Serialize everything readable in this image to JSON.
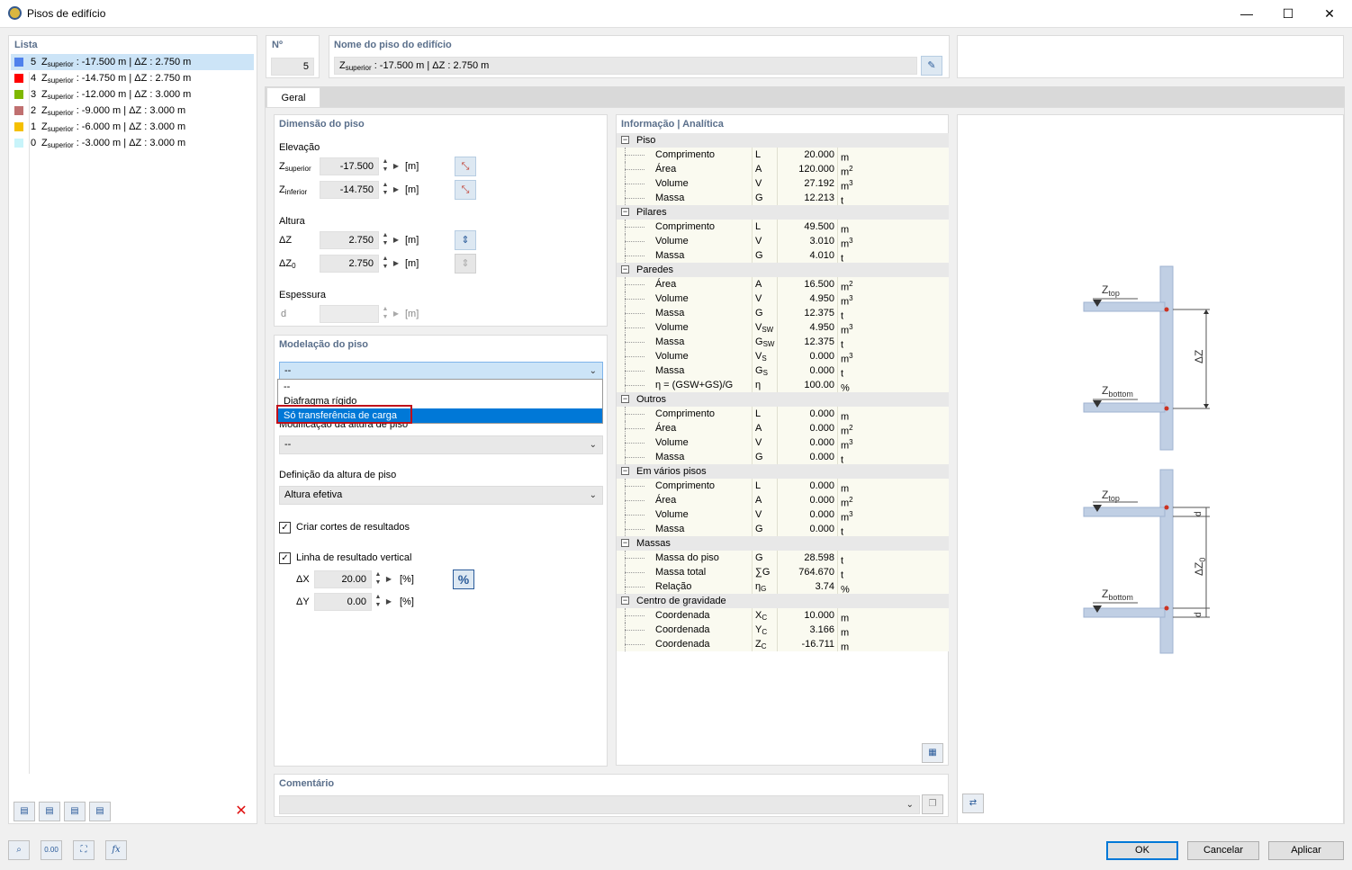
{
  "window": {
    "title": "Pisos de edifício",
    "controls": {
      "minimize": "—",
      "maximize": "☐",
      "close": "✕"
    }
  },
  "list": {
    "header": "Lista",
    "items": [
      {
        "n": "5",
        "color": "#4f81ec",
        "label_pre": "Z",
        "label_sub": "superior",
        "label_post": " : -17.500 m | ΔZ : 2.750 m",
        "selected": true
      },
      {
        "n": "4",
        "color": "#ff0000",
        "label_pre": "Z",
        "label_sub": "superior",
        "label_post": " : -14.750 m | ΔZ : 2.750 m"
      },
      {
        "n": "3",
        "color": "#7fb800",
        "label_pre": "Z",
        "label_sub": "superior",
        "label_post": " : -12.000 m | ΔZ : 3.000 m"
      },
      {
        "n": "2",
        "color": "#c07070",
        "label_pre": "Z",
        "label_sub": "superior",
        "label_post": " : -9.000 m | ΔZ : 3.000 m"
      },
      {
        "n": "1",
        "color": "#f5c000",
        "label_pre": "Z",
        "label_sub": "superior",
        "label_post": " : -6.000 m | ΔZ : 3.000 m"
      },
      {
        "n": "0",
        "color": "#c8f4fa",
        "label_pre": "Z",
        "label_sub": "superior",
        "label_post": " : -3.000 m | ΔZ : 3.000 m"
      }
    ]
  },
  "header": {
    "no_label": "Nº",
    "no_value": "5",
    "name_label": "Nome do piso do edifício",
    "name_pre": "Z",
    "name_sub": "superior",
    "name_post": " : -17.500 m | ΔZ : 2.750 m"
  },
  "tabs": [
    {
      "label": "Geral"
    }
  ],
  "dimension": {
    "header": "Dimensão do piso",
    "elevation_label": "Elevação",
    "z_sup_pre": "Z",
    "z_sup_sub": "superior",
    "z_sup_value": "-17.500",
    "z_sup_unit": "[m]",
    "z_inf_pre": "Z",
    "z_inf_sub": "inferior",
    "z_inf_value": "-14.750",
    "z_inf_unit": "[m]",
    "height_label": "Altura",
    "dz_label": "ΔZ",
    "dz_value": "2.750",
    "dz_unit": "[m]",
    "dz0_pre": "ΔZ",
    "dz0_sub": "0",
    "dz0_value": "2.750",
    "dz0_unit": "[m]",
    "thickness_label": "Espessura",
    "d_label": "d",
    "d_value": "",
    "d_unit": "[m]"
  },
  "modelling": {
    "header": "Modelação do piso",
    "combo_value": "--",
    "dropdown_options": [
      "--",
      "Diafragma rígido",
      "Só transferência de carga"
    ],
    "highlighted_option": "Só transferência de carga",
    "height_mod_label": "Modificação da altura de piso",
    "height_mod_value": "--",
    "height_def_label": "Definição da altura de piso",
    "height_def_value": "Altura efetiva",
    "create_cuts_label": "Criar cortes de resultados",
    "create_cuts_checked": true,
    "vertical_line_label": "Linha de resultado vertical",
    "vertical_line_checked": true,
    "dx_label": "ΔX",
    "dx_value": "20.00",
    "dx_unit": "[%]",
    "dy_label": "ΔY",
    "dy_value": "0.00",
    "dy_unit": "[%]",
    "percent_button": "%"
  },
  "info": {
    "header": "Informação | Analítica",
    "groups": [
      {
        "name": "Piso",
        "rows": [
          {
            "label": "Comprimento",
            "sym": "L",
            "sym_sub": "",
            "value": "20.000",
            "unit": "m",
            "unit_sup": ""
          },
          {
            "label": "Área",
            "sym": "A",
            "sym_sub": "",
            "value": "120.000",
            "unit": "m",
            "unit_sup": "2"
          },
          {
            "label": "Volume",
            "sym": "V",
            "sym_sub": "",
            "value": "27.192",
            "unit": "m",
            "unit_sup": "3"
          },
          {
            "label": "Massa",
            "sym": "G",
            "sym_sub": "",
            "value": "12.213",
            "unit": "t",
            "unit_sup": ""
          }
        ]
      },
      {
        "name": "Pilares",
        "rows": [
          {
            "label": "Comprimento",
            "sym": "L",
            "sym_sub": "",
            "value": "49.500",
            "unit": "m",
            "unit_sup": ""
          },
          {
            "label": "Volume",
            "sym": "V",
            "sym_sub": "",
            "value": "3.010",
            "unit": "m",
            "unit_sup": "3"
          },
          {
            "label": "Massa",
            "sym": "G",
            "sym_sub": "",
            "value": "4.010",
            "unit": "t",
            "unit_sup": ""
          }
        ]
      },
      {
        "name": "Paredes",
        "rows": [
          {
            "label": "Área",
            "sym": "A",
            "sym_sub": "",
            "value": "16.500",
            "unit": "m",
            "unit_sup": "2"
          },
          {
            "label": "Volume",
            "sym": "V",
            "sym_sub": "",
            "value": "4.950",
            "unit": "m",
            "unit_sup": "3"
          },
          {
            "label": "Massa",
            "sym": "G",
            "sym_sub": "",
            "value": "12.375",
            "unit": "t",
            "unit_sup": ""
          },
          {
            "label": "Volume",
            "sym": "V",
            "sym_sub": "SW",
            "value": "4.950",
            "unit": "m",
            "unit_sup": "3"
          },
          {
            "label": "Massa",
            "sym": "G",
            "sym_sub": "SW",
            "value": "12.375",
            "unit": "t",
            "unit_sup": ""
          },
          {
            "label": "Volume",
            "sym": "V",
            "sym_sub": "S",
            "value": "0.000",
            "unit": "m",
            "unit_sup": "3"
          },
          {
            "label": "Massa",
            "sym": "G",
            "sym_sub": "S",
            "value": "0.000",
            "unit": "t",
            "unit_sup": ""
          },
          {
            "label": "η = (GSW+GS)/G",
            "sym": "η",
            "sym_sub": "",
            "value": "100.00",
            "unit": "%",
            "unit_sup": ""
          }
        ]
      },
      {
        "name": "Outros",
        "rows": [
          {
            "label": "Comprimento",
            "sym": "L",
            "sym_sub": "",
            "value": "0.000",
            "unit": "m",
            "unit_sup": ""
          },
          {
            "label": "Área",
            "sym": "A",
            "sym_sub": "",
            "value": "0.000",
            "unit": "m",
            "unit_sup": "2"
          },
          {
            "label": "Volume",
            "sym": "V",
            "sym_sub": "",
            "value": "0.000",
            "unit": "m",
            "unit_sup": "3"
          },
          {
            "label": "Massa",
            "sym": "G",
            "sym_sub": "",
            "value": "0.000",
            "unit": "t",
            "unit_sup": ""
          }
        ]
      },
      {
        "name": "Em vários pisos",
        "rows": [
          {
            "label": "Comprimento",
            "sym": "L",
            "sym_sub": "",
            "value": "0.000",
            "unit": "m",
            "unit_sup": ""
          },
          {
            "label": "Área",
            "sym": "A",
            "sym_sub": "",
            "value": "0.000",
            "unit": "m",
            "unit_sup": "2"
          },
          {
            "label": "Volume",
            "sym": "V",
            "sym_sub": "",
            "value": "0.000",
            "unit": "m",
            "unit_sup": "3"
          },
          {
            "label": "Massa",
            "sym": "G",
            "sym_sub": "",
            "value": "0.000",
            "unit": "t",
            "unit_sup": ""
          }
        ]
      },
      {
        "name": "Massas",
        "rows": [
          {
            "label": "Massa do piso",
            "sym": "G",
            "sym_sub": "",
            "value": "28.598",
            "unit": "t",
            "unit_sup": ""
          },
          {
            "label": "Massa total",
            "sym": "∑G",
            "sym_sub": "",
            "value": "764.670",
            "unit": "t",
            "unit_sup": ""
          },
          {
            "label": "Relação",
            "sym": "η",
            "sym_sub": "G",
            "value": "3.74",
            "unit": "%",
            "unit_sup": ""
          }
        ]
      },
      {
        "name": "Centro de gravidade",
        "rows": [
          {
            "label": "Coordenada",
            "sym": "X",
            "sym_sub": "C",
            "value": "10.000",
            "unit": "m",
            "unit_sup": ""
          },
          {
            "label": "Coordenada",
            "sym": "Y",
            "sym_sub": "C",
            "value": "3.166",
            "unit": "m",
            "unit_sup": ""
          },
          {
            "label": "Coordenada",
            "sym": "Z",
            "sym_sub": "C",
            "value": "-16.711",
            "unit": "m",
            "unit_sup": ""
          }
        ]
      }
    ]
  },
  "diagram": {
    "z_top": "Z",
    "z_top_sub": "top",
    "z_bottom": "Z",
    "z_bottom_sub": "bottom",
    "dz": "ΔZ",
    "dz0": "ΔZ",
    "dz0_sub": "0",
    "d": "d",
    "plate_color": "#c0cfe4",
    "node_color": "#cc3322"
  },
  "comment": {
    "header": "Comentário",
    "value": ""
  },
  "footer": {
    "ok": "OK",
    "cancel": "Cancelar",
    "apply": "Aplicar",
    "tool_numbers": "0.00",
    "tool_fx": "fx"
  }
}
